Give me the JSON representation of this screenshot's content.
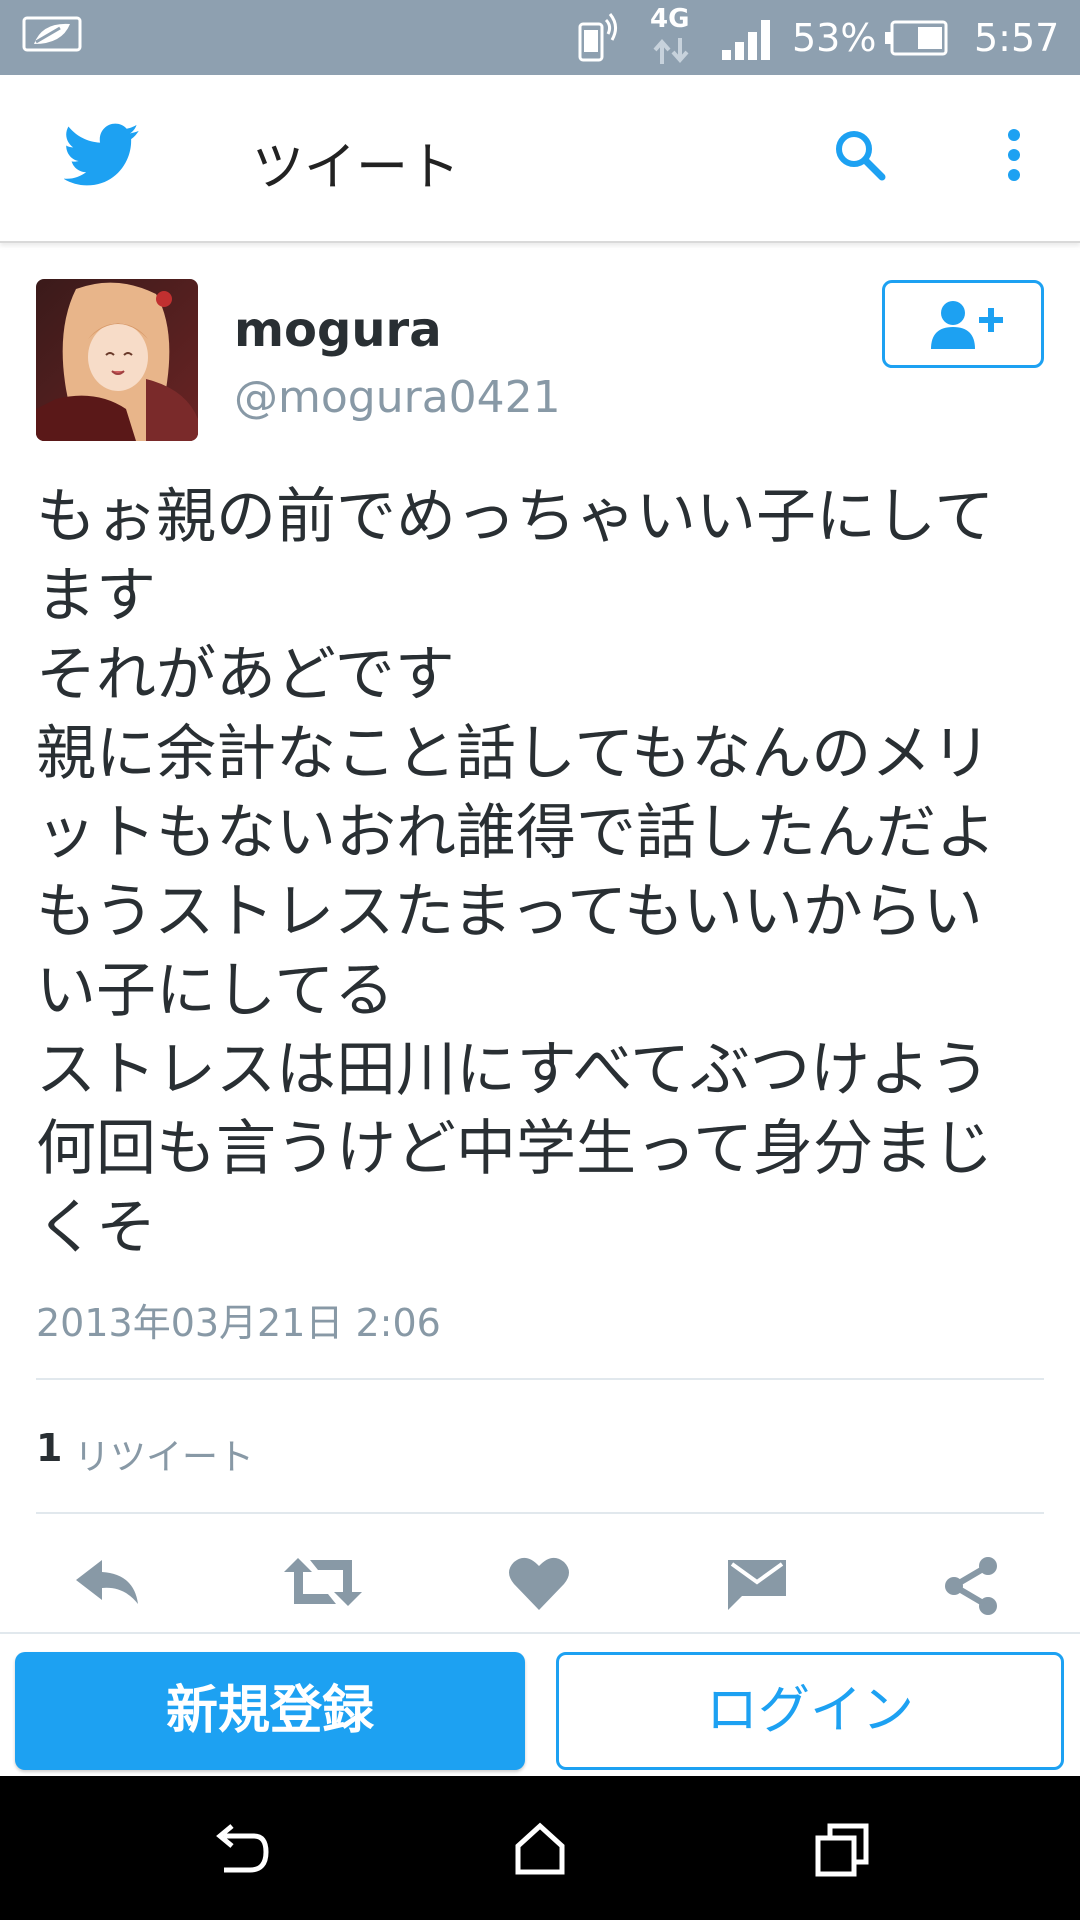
{
  "status_bar": {
    "network": "4G",
    "battery_percent": "53%",
    "time": "5:57",
    "icons": [
      "notification-leaf-icon",
      "vibrate-phone-icon",
      "data-arrows-icon",
      "signal-icon",
      "battery-icon"
    ]
  },
  "app_bar": {
    "title": "ツイート",
    "icons": [
      "twitter-bird-icon",
      "search-icon",
      "more-vert-icon"
    ]
  },
  "tweet": {
    "user": {
      "name": "mogura",
      "handle": "@mogura0421"
    },
    "text_lines": [
      "もぉ親の前でめっちゃいい子にして",
      "ます",
      "それがあどです",
      "親に余計なこと話してもなんのメリ",
      "ットもないおれ誰得で話したんだよ",
      "もうストレスたまってもいいからい",
      "い子にしてる",
      "ストレスは田川にすべてぶつけよう",
      "何回も言うけど中学生って身分まじ",
      "くそ"
    ],
    "date": "2013年03月21日 2:06",
    "retweet_count": "1",
    "retweet_label": "リツイート",
    "actions": [
      "reply-icon",
      "retweet-icon",
      "like-icon",
      "message-icon",
      "share-icon"
    ]
  },
  "buttons": {
    "signup": "新規登録",
    "login": "ログイン"
  },
  "nav_bar": [
    "back-icon",
    "home-icon",
    "recents-icon"
  ],
  "colors": {
    "accent": "#1da1f2",
    "status_bar": "#8ea0b0",
    "text_primary": "#292f33",
    "text_secondary": "#8899a6",
    "action_icon": "#8899a6"
  }
}
